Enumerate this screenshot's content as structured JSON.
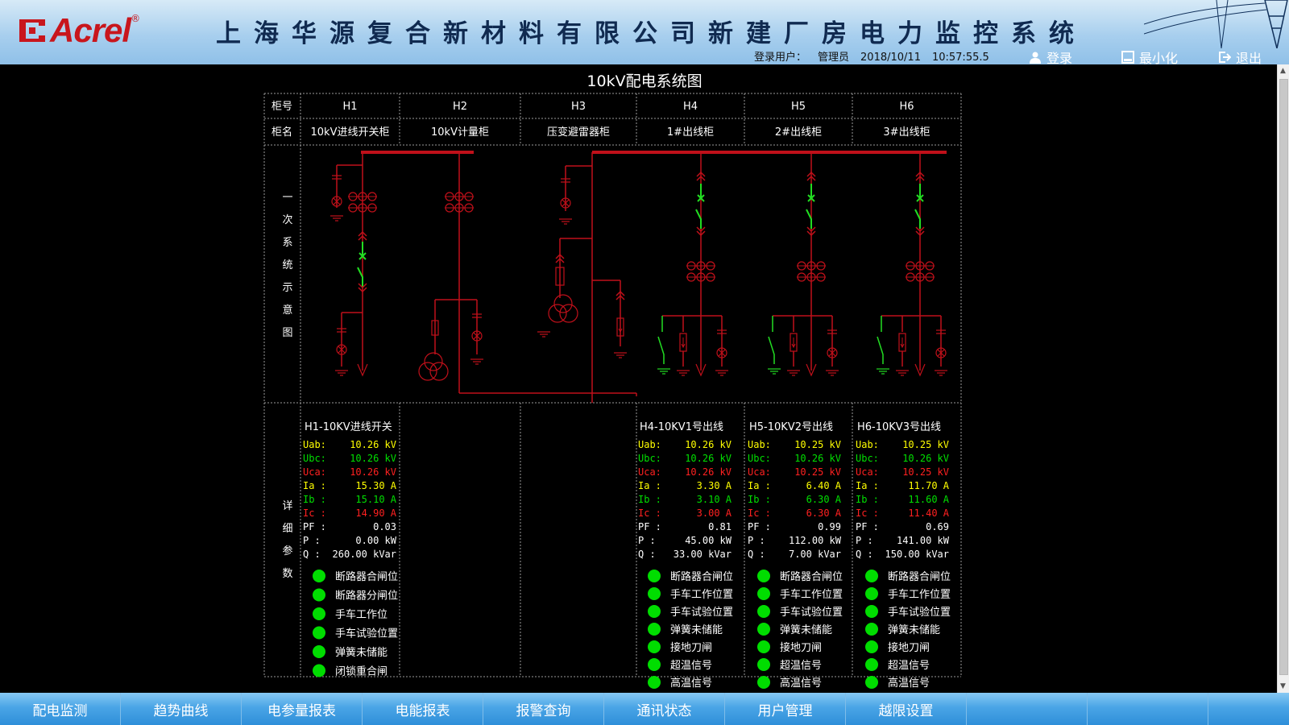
{
  "header": {
    "brand": "Acrel",
    "reg_mark": "®",
    "title": "上海华源复合新材料有限公司新建厂房电力监控系统",
    "user_label": "登录用户：",
    "user_name": "管理员",
    "date": "2018/10/11",
    "time": "10:57:55.5",
    "login_label": "登录",
    "minimize_label": "最小化",
    "exit_label": "退出"
  },
  "page_title": "10kV配电系统图",
  "table": {
    "row_cabinet_no": "柜号",
    "row_cabinet_name": "柜名",
    "section_primary": [
      "一",
      "次",
      "系",
      "统",
      "示",
      "意",
      "图"
    ],
    "section_detail": [
      "详",
      "细",
      "参",
      "数"
    ],
    "cabinets": [
      {
        "no": "H1",
        "name": "10kV进线开关柜"
      },
      {
        "no": "H2",
        "name": "10kV计量柜"
      },
      {
        "no": "H3",
        "name": "压变避雷器柜"
      },
      {
        "no": "H4",
        "name": "1#出线柜"
      },
      {
        "no": "H5",
        "name": "2#出线柜"
      },
      {
        "no": "H6",
        "name": "3#出线柜"
      }
    ]
  },
  "details": [
    {
      "title": "H1-10KV进线开关",
      "params": [
        {
          "label": "Uab:",
          "value": "10.26 kV",
          "color": "#ffff00"
        },
        {
          "label": "Ubc:",
          "value": "10.26 kV",
          "color": "#00e000"
        },
        {
          "label": "Uca:",
          "value": "10.26 kV",
          "color": "#ff2020"
        },
        {
          "label": "Ia :",
          "value": "15.30 A",
          "color": "#ffff00"
        },
        {
          "label": "Ib :",
          "value": "15.10 A",
          "color": "#00e000"
        },
        {
          "label": "Ic :",
          "value": "14.90 A",
          "color": "#ff2020"
        },
        {
          "label": "PF :",
          "value": "0.03",
          "color": "#ffffff"
        },
        {
          "label": "P  :",
          "value": "0.00 kW",
          "color": "#ffffff"
        },
        {
          "label": "Q  :",
          "value": "260.00 kVar",
          "color": "#ffffff"
        }
      ],
      "status": [
        "断路器合闸位",
        "断路器分闸位",
        "手车工作位",
        "手车试验位置",
        "弹簧未储能",
        "闭锁重合闸"
      ]
    },
    {
      "title": "H4-10KV1号出线",
      "params": [
        {
          "label": "Uab:",
          "value": "10.26 kV",
          "color": "#ffff00"
        },
        {
          "label": "Ubc:",
          "value": "10.26 kV",
          "color": "#00e000"
        },
        {
          "label": "Uca:",
          "value": "10.26 kV",
          "color": "#ff2020"
        },
        {
          "label": "Ia :",
          "value": "3.30 A",
          "color": "#ffff00"
        },
        {
          "label": "Ib :",
          "value": "3.10 A",
          "color": "#00e000"
        },
        {
          "label": "Ic :",
          "value": "3.00 A",
          "color": "#ff2020"
        },
        {
          "label": "PF :",
          "value": "0.81",
          "color": "#ffffff"
        },
        {
          "label": "P  :",
          "value": "45.00 kW",
          "color": "#ffffff"
        },
        {
          "label": "Q  :",
          "value": "33.00 kVar",
          "color": "#ffffff"
        }
      ],
      "status": [
        "断路器合闸位",
        "手车工作位置",
        "手车试验位置",
        "弹簧未储能",
        "接地刀闸",
        "超温信号",
        "高温信号"
      ]
    },
    {
      "title": "H5-10KV2号出线",
      "params": [
        {
          "label": "Uab:",
          "value": "10.25 kV",
          "color": "#ffff00"
        },
        {
          "label": "Ubc:",
          "value": "10.26 kV",
          "color": "#00e000"
        },
        {
          "label": "Uca:",
          "value": "10.25 kV",
          "color": "#ff2020"
        },
        {
          "label": "Ia :",
          "value": "6.40 A",
          "color": "#ffff00"
        },
        {
          "label": "Ib :",
          "value": "6.30 A",
          "color": "#00e000"
        },
        {
          "label": "Ic :",
          "value": "6.30 A",
          "color": "#ff2020"
        },
        {
          "label": "PF :",
          "value": "0.99",
          "color": "#ffffff"
        },
        {
          "label": "P  :",
          "value": "112.00 kW",
          "color": "#ffffff"
        },
        {
          "label": "Q  :",
          "value": "7.00 kVar",
          "color": "#ffffff"
        }
      ],
      "status": [
        "断路器合闸位",
        "手车工作位置",
        "手车试验位置",
        "弹簧未储能",
        "接地刀闸",
        "超温信号",
        "高温信号"
      ]
    },
    {
      "title": "H6-10KV3号出线",
      "params": [
        {
          "label": "Uab:",
          "value": "10.25 kV",
          "color": "#ffff00"
        },
        {
          "label": "Ubc:",
          "value": "10.26 kV",
          "color": "#00e000"
        },
        {
          "label": "Uca:",
          "value": "10.25 kV",
          "color": "#ff2020"
        },
        {
          "label": "Ia :",
          "value": "11.70 A",
          "color": "#ffff00"
        },
        {
          "label": "Ib :",
          "value": "11.60 A",
          "color": "#00e000"
        },
        {
          "label": "Ic :",
          "value": "11.40 A",
          "color": "#ff2020"
        },
        {
          "label": "PF :",
          "value": "0.69",
          "color": "#ffffff"
        },
        {
          "label": "P  :",
          "value": "141.00 kW",
          "color": "#ffffff"
        },
        {
          "label": "Q  :",
          "value": "150.00 kVar",
          "color": "#ffffff"
        }
      ],
      "status": [
        "断路器合闸位",
        "手车工作位置",
        "手车试验位置",
        "弹簧未储能",
        "接地刀闸",
        "超温信号",
        "高温信号"
      ]
    }
  ],
  "nav": [
    "配电监测",
    "趋势曲线",
    "电参量报表",
    "电能报表",
    "报警查询",
    "通讯状态",
    "用户管理",
    "越限设置",
    "",
    ""
  ],
  "colors": {
    "bus": "#c0101a",
    "equip": "#c0101a",
    "closed_switch": "#22dd22",
    "led": "#00dd00",
    "header_title": "#102a50",
    "nav_bg": "#3a98de"
  }
}
